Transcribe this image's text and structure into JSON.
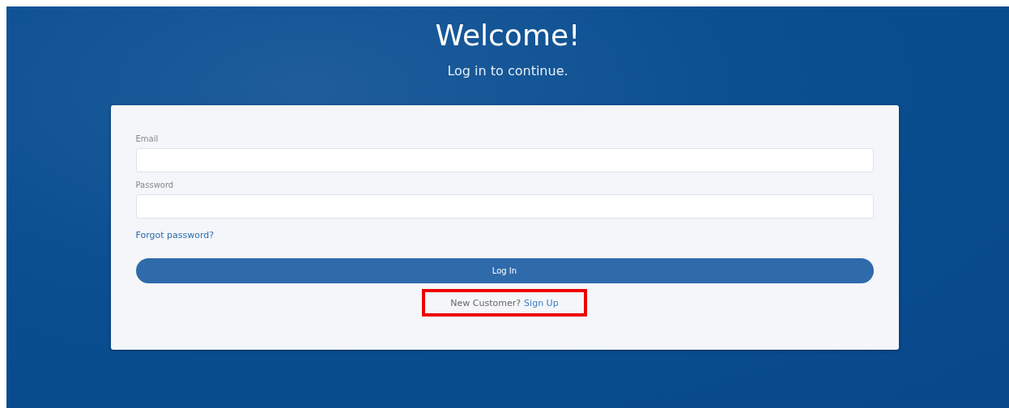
{
  "header": {
    "title": "Welcome!",
    "subtitle": "Log in to continue."
  },
  "form": {
    "fields": [
      {
        "label": "Email"
      },
      {
        "label": "Password"
      }
    ],
    "forgot_link": "Forgot password?",
    "submit_button": "Log In",
    "signup": {
      "prompt": "New Customer?",
      "link": "Sign Up",
      "highlighted": true
    }
  }
}
